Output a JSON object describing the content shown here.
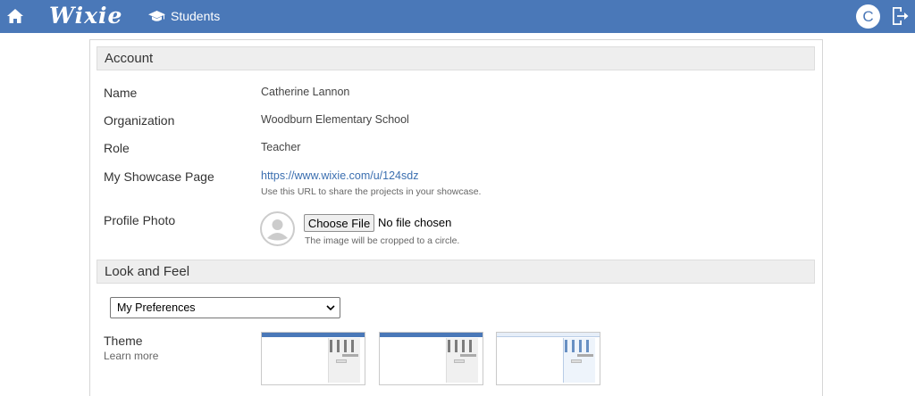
{
  "topbar": {
    "home_icon": "home-icon",
    "logo": "Wixie",
    "students_label": "Students",
    "students_icon": "graduation-cap-icon",
    "user_initial": "C",
    "logout_icon": "logout-icon",
    "bar_color": "#4a78b8"
  },
  "account": {
    "section_title": "Account",
    "name_label": "Name",
    "name_value": "Catherine Lannon",
    "org_label": "Organization",
    "org_value": "Woodburn Elementary School",
    "role_label": "Role",
    "role_value": "Teacher",
    "showcase_label": "My Showcase Page",
    "showcase_url": "https://www.wixie.com/u/124sdz",
    "showcase_hint": "Use this URL to share the projects in your showcase.",
    "photo_label": "Profile Photo",
    "choose_file": "Choose File",
    "no_file": "No file chosen",
    "photo_hint": "The image will be cropped to a circle."
  },
  "look": {
    "section_title": "Look and Feel",
    "preferences_selected": "My Preferences",
    "theme_label": "Theme",
    "learn_more": "Learn more",
    "themes": [
      "theme-classic",
      "theme-classic-alt",
      "theme-light"
    ]
  }
}
